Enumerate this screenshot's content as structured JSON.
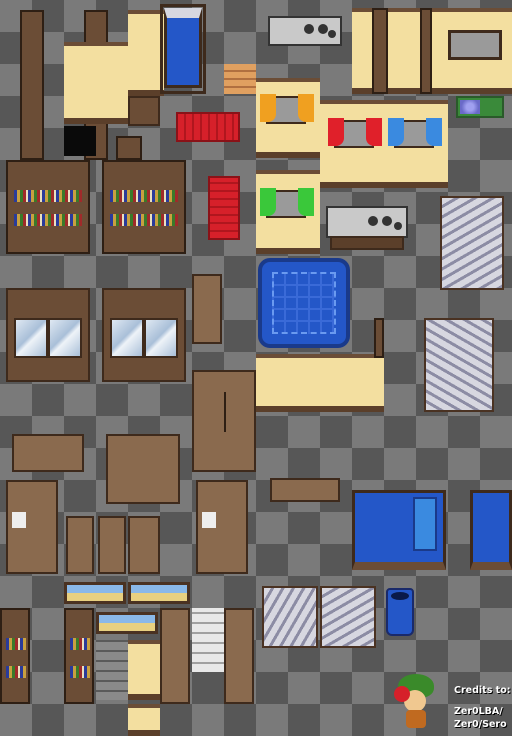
{
  "credits": {
    "heading": "Credits to:",
    "line1": "Zer0LBA/",
    "line2": "Zer0/Sero"
  },
  "palette": {
    "wood": "#8a6a4e",
    "wood_outline": "#3e2a1c",
    "wall_cream": "#f3dfa0",
    "bed_blue": "#2457c8",
    "rug_red": "#d6202a",
    "curtain_orange": "#f0a020",
    "curtain_red": "#e0202a",
    "curtain_blue": "#3a8ae0",
    "curtain_green": "#3ac83a",
    "checker_light": "#7a7a7a",
    "checker_dark": "#575757"
  },
  "sprites": [
    "wall-pillar",
    "window-wall",
    "bed-blue",
    "kitchen-stove",
    "curtained-window",
    "bookcase",
    "red-rug",
    "blue-square-rug",
    "glass-cabinet",
    "staircase",
    "table",
    "wardrobe",
    "dresser",
    "chair",
    "double-bed",
    "trash-bin",
    "wall-painting",
    "mascot-credit"
  ]
}
